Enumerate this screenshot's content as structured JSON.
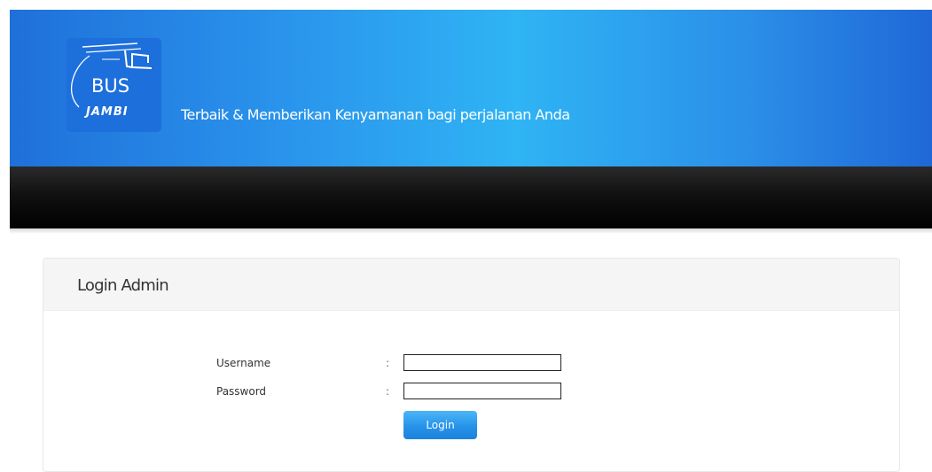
{
  "header": {
    "logo_line1": "BUS",
    "logo_line2": "JAMBI",
    "tagline": "Terbaik & Memberikan Kenyamanan bagi perjalanan Anda"
  },
  "login": {
    "title": "Login Admin",
    "username_label": "Username",
    "password_label": "Password",
    "separator": ":",
    "username_value": "",
    "password_value": "",
    "submit_label": "Login"
  },
  "colors": {
    "header_blue": "#2a94ec",
    "navbar_black": "#000000",
    "button_blue": "#2693ea"
  }
}
